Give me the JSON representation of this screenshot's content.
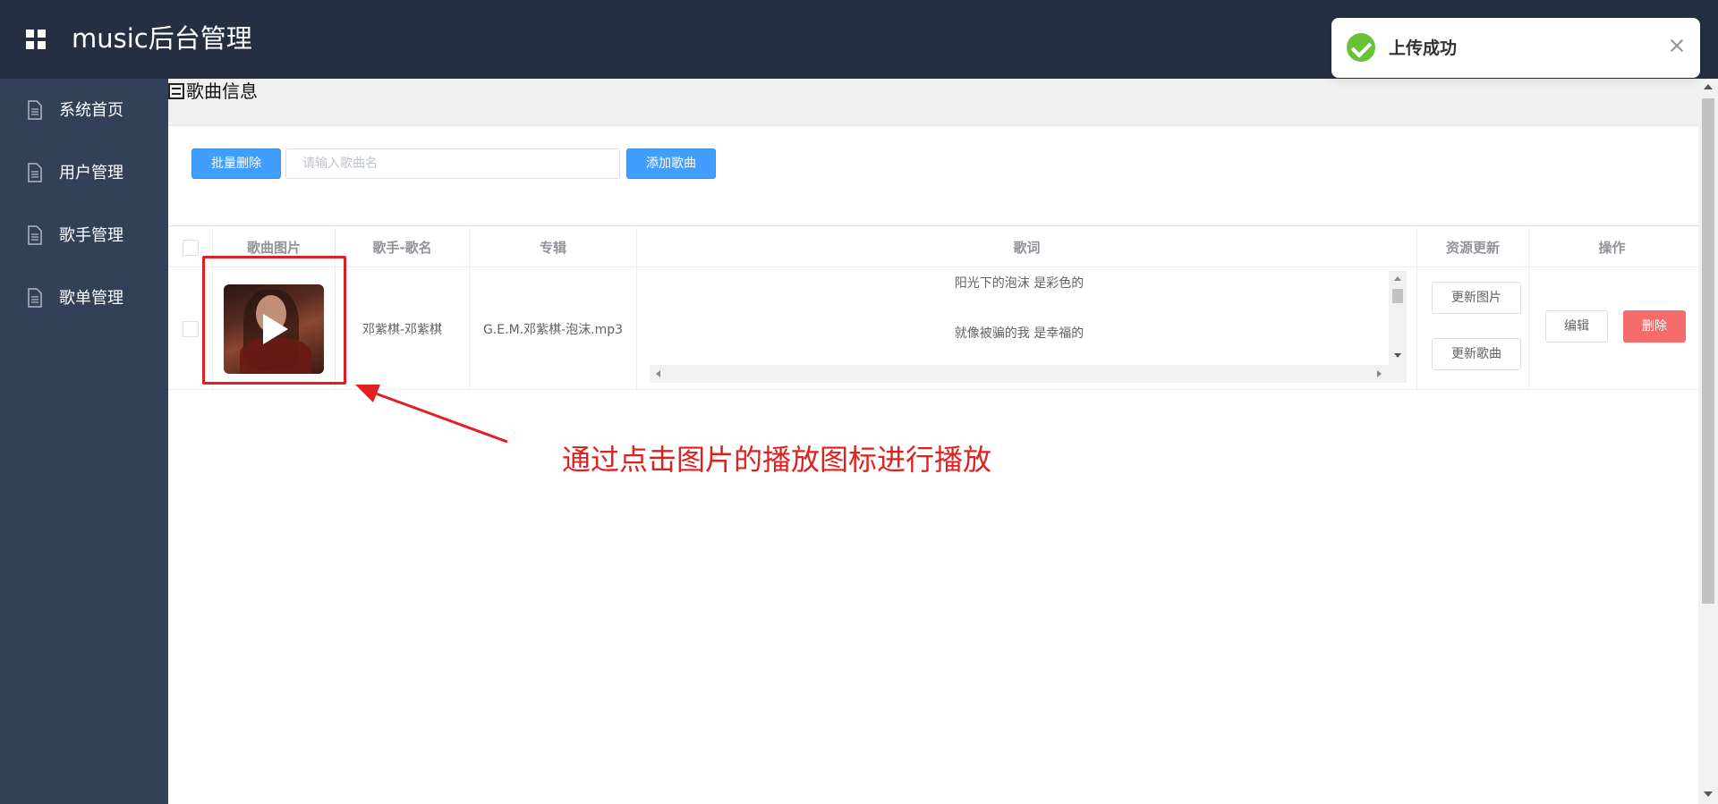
{
  "header": {
    "title": "music后台管理",
    "menu_icon": "grid-icon"
  },
  "sidebar": {
    "items": [
      {
        "label": "系统首页",
        "icon": "document-icon"
      },
      {
        "label": "用户管理",
        "icon": "document-icon"
      },
      {
        "label": "歌手管理",
        "icon": "document-icon"
      },
      {
        "label": "歌单管理",
        "icon": "document-icon"
      }
    ]
  },
  "breadcrumb": {
    "label": "歌曲信息",
    "icon": "menu-icon"
  },
  "toolbar": {
    "batch_delete_label": "批量删除",
    "search_placeholder": "请输入歌曲名",
    "add_song_label": "添加歌曲"
  },
  "table": {
    "headers": [
      "歌曲图片",
      "歌手-歌名",
      "专辑",
      "歌词",
      "资源更新",
      "操作"
    ],
    "rows": [
      {
        "singer_song": "邓紫棋-邓紫棋",
        "album": "G.E.M.邓紫棋-泡沫.mp3",
        "lyrics": [
          "阳光下的泡沫 是彩色的",
          "就像被骗的我 是幸福的"
        ],
        "update_image_label": "更新图片",
        "update_song_label": "更新歌曲",
        "edit_label": "编辑",
        "delete_label": "删除"
      }
    ]
  },
  "annotation": {
    "text": "通过点击图片的播放图标进行播放",
    "color": "#e0201e"
  },
  "toast": {
    "message": "上传成功",
    "status_color": "#67c23a"
  },
  "colors": {
    "header_bg": "#242f42",
    "sidebar_bg": "#324157",
    "primary": "#409eff",
    "danger": "#f56c6c"
  }
}
